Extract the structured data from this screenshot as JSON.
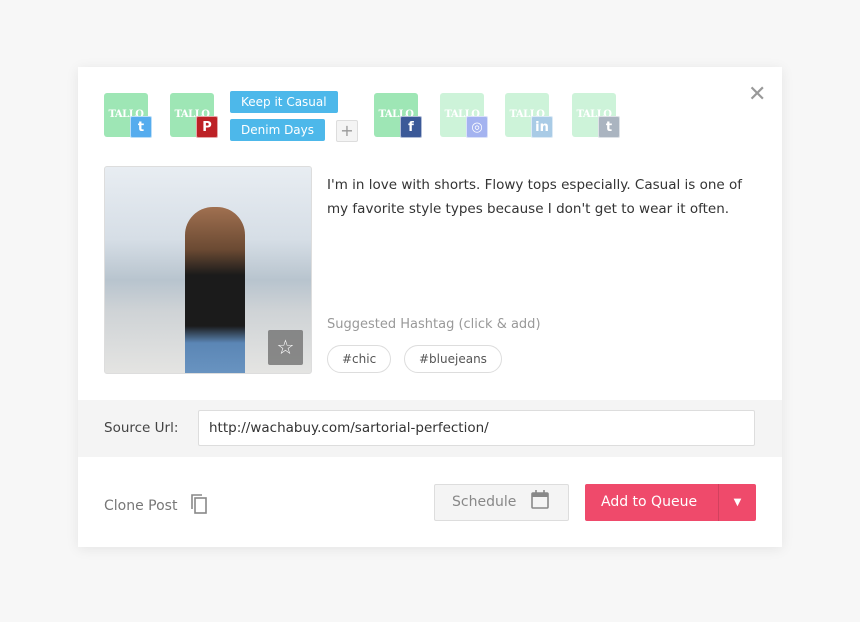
{
  "accounts": [
    {
      "name": "TALLO",
      "network": "twitter",
      "glyph": "t",
      "color": "#55acee",
      "dim": false
    },
    {
      "name": "TALLO",
      "network": "pinterest",
      "glyph": "P",
      "color": "#bd2126",
      "dim": false
    },
    {
      "name": "TALLO",
      "network": "facebook",
      "glyph": "f",
      "color": "#3b5998",
      "dim": false
    },
    {
      "name": "TALLO",
      "network": "instagram",
      "glyph": "◎",
      "color": "#a4b3f0",
      "dim": true
    },
    {
      "name": "TALLO",
      "network": "linkedin",
      "glyph": "in",
      "color": "#a9cbe6",
      "dim": true
    },
    {
      "name": "TALLO",
      "network": "tumblr",
      "glyph": "t",
      "color": "#aab4c0",
      "dim": true
    }
  ],
  "labels": [
    "Keep it Casual",
    "Denim Days"
  ],
  "plus": "+",
  "close": "✕",
  "post_text": "I'm in love with shorts. Flowy tops especially. Casual is one of my favorite style types because I don't get to wear it often.",
  "suggested_label": "Suggested Hashtag (click & add)",
  "hashtags": [
    "#chic",
    "#bluejeans"
  ],
  "source_label": "Source Url:",
  "source_url": "http://wachabuy.com/sartorial-perfection/",
  "clone_label": "Clone Post",
  "schedule_label": "Schedule",
  "queue_label": "Add to Queue",
  "colors": {
    "accent": "#ef4a6b",
    "label": "#4db8ea"
  }
}
